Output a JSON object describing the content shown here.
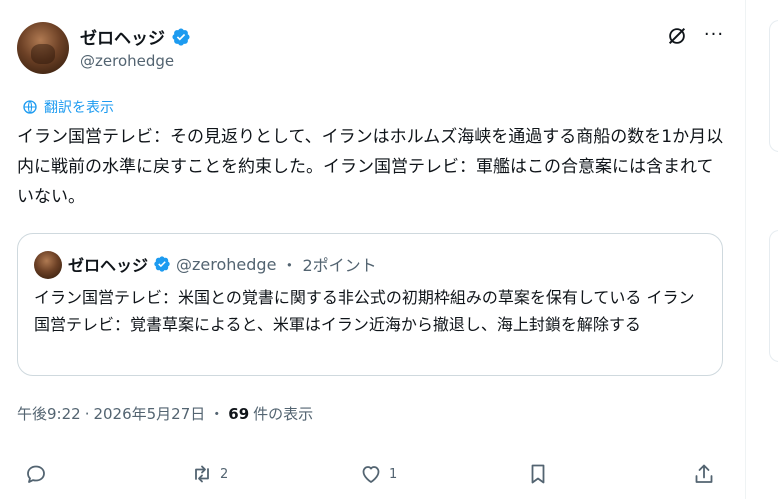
{
  "author": {
    "display_name": "ゼロヘッジ",
    "handle": "@zerohedge",
    "verified": true
  },
  "icons": {
    "grok": "grok-icon",
    "more": "more-icon",
    "translate": "globe-icon",
    "reply": "reply-icon",
    "retweet": "retweet-icon",
    "like": "heart-icon",
    "bookmark": "bookmark-icon",
    "share": "share-icon"
  },
  "translate_label": "翻訳を表示",
  "tweet_text": "イラン国営テレビ：その見返りとして、イランはホルムズ海峡を通過する商船の数を1か月以内に戦前の水準に戻すことを約束した。イラン国営テレビ：軍艦はこの合意案には含まれていない。",
  "quote": {
    "display_name": "ゼロヘッジ",
    "handle": "@zerohedge",
    "separator": "・",
    "meta": "2ポイント",
    "text": "イラン国営テレビ：米国との覚書に関する非公式の初期枠組みの草案を保有している イラン国営テレビ：覚書草案によると、米軍はイラン近海から撤退し、海上封鎖を解除する"
  },
  "meta": {
    "time": "午後9:22",
    "dot": "·",
    "date": "2026年5月27日",
    "separator": "・",
    "views_count": "69",
    "views_label": "件の表示"
  },
  "actions": {
    "reply_count": "",
    "retweet_count": "2",
    "like_count": "1"
  },
  "colors": {
    "accent": "#1d9bf0",
    "text": "#0f1419",
    "secondary": "#536471",
    "border": "#cfd9de"
  }
}
